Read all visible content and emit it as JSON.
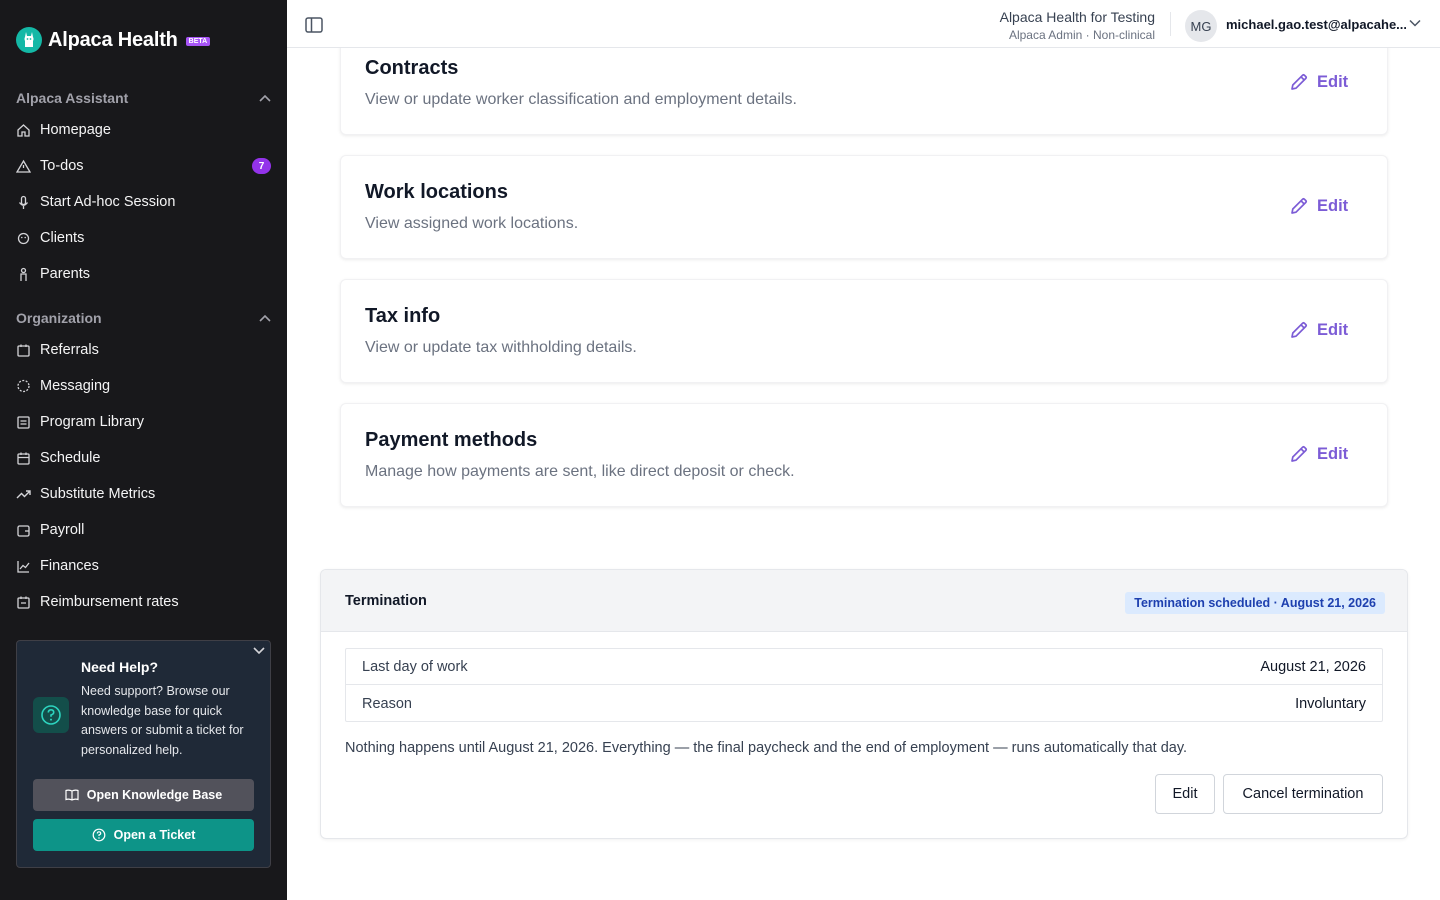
{
  "brand": {
    "name": "Alpaca Health",
    "badge": "BETA"
  },
  "sidebar": {
    "sections": [
      {
        "title": "Alpaca Assistant",
        "items": [
          {
            "label": "Homepage",
            "icon": "home-icon"
          },
          {
            "label": "To-dos",
            "icon": "alert-triangle-icon",
            "badge": "7"
          },
          {
            "label": "Start Ad-hoc Session",
            "icon": "microphone-icon"
          },
          {
            "label": "Clients",
            "icon": "clients-icon"
          },
          {
            "label": "Parents",
            "icon": "parent-icon"
          }
        ]
      },
      {
        "title": "Organization",
        "items": [
          {
            "label": "Referrals",
            "icon": "referrals-icon"
          },
          {
            "label": "Messaging",
            "icon": "message-icon"
          },
          {
            "label": "Program Library",
            "icon": "library-icon"
          },
          {
            "label": "Schedule",
            "icon": "calendar-icon"
          },
          {
            "label": "Substitute Metrics",
            "icon": "trending-up-icon"
          },
          {
            "label": "Payroll",
            "icon": "wallet-icon"
          },
          {
            "label": "Finances",
            "icon": "line-chart-icon"
          },
          {
            "label": "Reimbursement rates",
            "icon": "rates-icon"
          }
        ]
      }
    ],
    "help": {
      "title": "Need Help?",
      "body": "Need support? Browse our knowledge base for quick answers or submit a ticket for personalized help.",
      "kb_button": "Open Knowledge Base",
      "ticket_button": "Open a Ticket"
    }
  },
  "topbar": {
    "org_name": "Alpaca Health for Testing",
    "org_sub": "Alpaca Admin · Non-clinical",
    "avatar_initials": "MG",
    "user_email": "michael.gao.test@alpacahe..."
  },
  "cards": [
    {
      "title": "Contracts",
      "description": "View or update worker classification and employment details.",
      "action": "Edit"
    },
    {
      "title": "Work locations",
      "description": "View assigned work locations.",
      "action": "Edit"
    },
    {
      "title": "Tax info",
      "description": "View or update tax withholding details.",
      "action": "Edit"
    },
    {
      "title": "Payment methods",
      "description": "Manage how payments are sent, like direct deposit or check.",
      "action": "Edit"
    }
  ],
  "termination": {
    "title": "Termination",
    "badge": "Termination scheduled · August 21, 2026",
    "rows": [
      {
        "label": "Last day of work",
        "value": "August 21, 2026"
      },
      {
        "label": "Reason",
        "value": "Involuntary"
      }
    ],
    "note": "Nothing happens until August 21, 2026. Everything — the final paycheck and the end of employment — runs automatically that day.",
    "edit_button": "Edit",
    "cancel_button": "Cancel termination"
  },
  "colors": {
    "sidebar_bg": "#18181b",
    "accent_purple": "#7c5cd6",
    "teal": "#0d9488",
    "badge_blue": "#dbeafe"
  }
}
